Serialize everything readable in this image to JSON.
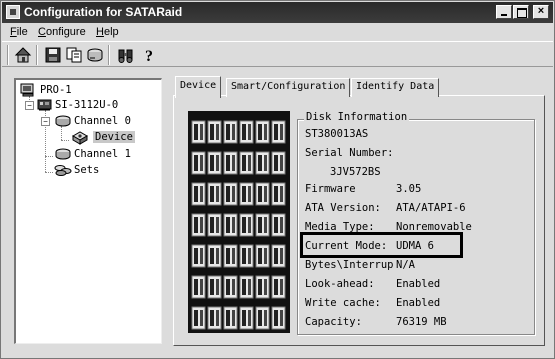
{
  "window": {
    "title": "Configuration for SATARaid",
    "controls": {
      "minimize": "minimize",
      "maximize": "maximize",
      "close": "×"
    }
  },
  "menu": {
    "items": [
      {
        "label": "File"
      },
      {
        "label": "Configure"
      },
      {
        "label": "Help"
      }
    ]
  },
  "toolbar": {
    "icons": [
      "home-icon",
      "save-icon",
      "copy-icon",
      "drive-icon",
      "binoculars-icon",
      "help-icon"
    ]
  },
  "tree": {
    "root": "PRO-1",
    "controller": "SI-3112U-0",
    "channel0": "Channel 0",
    "device": "Device",
    "channel1": "Channel 1",
    "sets": "Sets"
  },
  "tabs": [
    {
      "label": "Device",
      "active": true
    },
    {
      "label": "Smart/Configuration",
      "active": false
    },
    {
      "label": "Identify Data",
      "active": false
    }
  ],
  "disk_info": {
    "group_title": "Disk Information",
    "model": "ST380013AS",
    "serial_label": "Serial Number:",
    "serial_value": "3JV572BS",
    "rows": [
      {
        "label": "Firmware",
        "value": "3.05"
      },
      {
        "label": "ATA Version:",
        "value": "ATA/ATAPI-6"
      },
      {
        "label": "Media Type:",
        "value": "Nonremovable"
      },
      {
        "label": "Current Mode:",
        "value": "UDMA 6"
      },
      {
        "label": "Bytes\\Interrup",
        "value": "N/A"
      },
      {
        "label": "Look-ahead:",
        "value": "Enabled"
      },
      {
        "label": "Write cache:",
        "value": "Enabled"
      },
      {
        "label": "Capacity:",
        "value": "76319 MB"
      }
    ]
  }
}
